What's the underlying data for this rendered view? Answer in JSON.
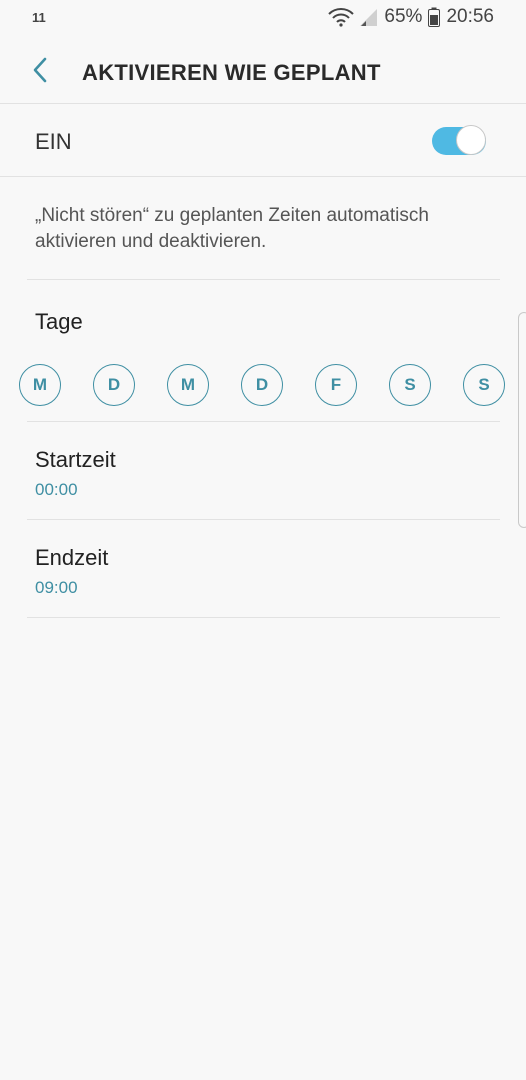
{
  "status_bar": {
    "left_text": "11",
    "battery_percent": "65%",
    "time": "20:56",
    "icons": [
      "wifi-icon",
      "signal-icon",
      "battery-icon"
    ]
  },
  "header": {
    "title": "AKTIVIEREN WIE GEPLANT",
    "back_icon": "chevron-left-icon"
  },
  "master_switch": {
    "label": "EIN",
    "on": true
  },
  "description": "„Nicht stören“ zu geplanten Zeiten automatisch aktivieren und deaktivieren.",
  "days_section": {
    "label": "Tage",
    "days": [
      {
        "label": "M"
      },
      {
        "label": "D"
      },
      {
        "label": "M"
      },
      {
        "label": "D"
      },
      {
        "label": "F"
      },
      {
        "label": "S"
      },
      {
        "label": "S"
      }
    ]
  },
  "start": {
    "title": "Startzeit",
    "value": "00:00"
  },
  "end": {
    "title": "Endzeit",
    "value": "09:00"
  },
  "colors": {
    "accent": "#3f8fa3",
    "toggle_on": "#4fb9e3",
    "background": "#f8f8f8"
  }
}
